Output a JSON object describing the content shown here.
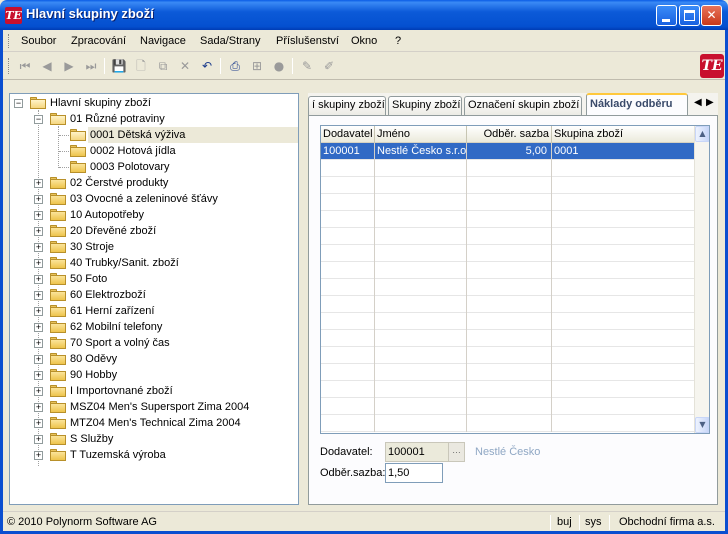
{
  "window": {
    "title": "Hlavní skupiny zboží",
    "app_icon_text": "TE",
    "controls": {
      "minimize": "minimize-icon",
      "maximize": "maximize-icon",
      "close": "✕"
    }
  },
  "menu": {
    "items": [
      "Soubor",
      "Zpracování",
      "Navigace",
      "Sada/Strany",
      "Příslušenství",
      "Okno",
      "?"
    ]
  },
  "toolbar": {
    "buttons": [
      {
        "icon": "first-record-icon",
        "glyph": "⏮"
      },
      {
        "icon": "previous-record-icon",
        "glyph": "◀"
      },
      {
        "icon": "next-record-icon",
        "glyph": "▶"
      },
      {
        "icon": "last-record-icon",
        "glyph": "⏭"
      },
      {
        "icon": "save-icon",
        "glyph": "💾"
      },
      {
        "icon": "new-document-icon",
        "glyph": "🗋"
      },
      {
        "icon": "copy-icon",
        "glyph": "⧉"
      },
      {
        "icon": "delete-icon",
        "glyph": "✕"
      },
      {
        "icon": "undo-icon",
        "glyph": "↶"
      },
      {
        "icon": "print-icon",
        "glyph": "⎙"
      },
      {
        "icon": "tree-view-icon",
        "glyph": "⊞"
      },
      {
        "icon": "stop-icon",
        "glyph": "●"
      },
      {
        "icon": "edit-icon",
        "glyph": "✎"
      },
      {
        "icon": "edit-clear-icon",
        "glyph": "✐"
      }
    ],
    "logo_text": "TE"
  },
  "tree": {
    "root_label": "Hlavní skupiny zboží",
    "nodes": [
      {
        "label": "01  Různé potraviny",
        "expanded": true,
        "level": 1
      },
      {
        "label": "0001  Dětská výživa",
        "level": 2,
        "selected": true,
        "open": true
      },
      {
        "label": "0002  Hotová jídla",
        "level": 2
      },
      {
        "label": "0003  Polotovary",
        "level": 2
      },
      {
        "label": "02  Čerstvé produkty",
        "level": 1
      },
      {
        "label": "03  Ovocné a zeleninové šťávy",
        "level": 1
      },
      {
        "label": "10  Autopotřeby",
        "level": 1
      },
      {
        "label": "20  Dřevěné zboží",
        "level": 1
      },
      {
        "label": "30  Stroje",
        "level": 1
      },
      {
        "label": "40  Trubky/Sanit. zboží",
        "level": 1
      },
      {
        "label": "50  Foto",
        "level": 1
      },
      {
        "label": "60  Elektrozboží",
        "level": 1
      },
      {
        "label": "61  Herní zařízení",
        "level": 1
      },
      {
        "label": "62  Mobilní telefony",
        "level": 1
      },
      {
        "label": "70  Sport a volný čas",
        "level": 1
      },
      {
        "label": "80  Oděvy",
        "level": 1
      },
      {
        "label": "90  Hobby",
        "level": 1
      },
      {
        "label": "I  Importovnané zboží",
        "level": 1
      },
      {
        "label": "MSZ04  Men's Supersport Zima 2004",
        "level": 1
      },
      {
        "label": "MTZ04  Men's Technical Zima 2004",
        "level": 1
      },
      {
        "label": "S  Služby",
        "level": 1
      },
      {
        "label": "T  Tuzemská výroba",
        "level": 1
      }
    ]
  },
  "tabs": {
    "items": [
      {
        "label": "í skupiny zboží"
      },
      {
        "label": "Skupiny zboží"
      },
      {
        "label": "Označení skupin zboží"
      },
      {
        "label": "Náklady odběru",
        "active": true
      }
    ],
    "nav_left": "◀",
    "nav_right": "▶"
  },
  "grid": {
    "columns": [
      "Dodavatel",
      "Jméno",
      "Odběr. sazba",
      "Skupina zboží"
    ],
    "rows": [
      {
        "dodavatel": "100001",
        "jmeno": "Nestlé Česko s.r.o.",
        "sazba": "5,00",
        "skupina": "0001",
        "selected": true
      }
    ],
    "scroll_up": "▲",
    "scroll_down": "▼"
  },
  "form": {
    "dodavatel_label": "Dodavatel:",
    "dodavatel_value": "100001",
    "dodavatel_name": "Nestlé Česko",
    "lookup_glyph": "…",
    "sazba_label": "Odběr.sazba:",
    "sazba_value": "1,50"
  },
  "status": {
    "copyright": "© 2010 Polynorm Software AG",
    "user": "buj",
    "db": "sys",
    "company": "Obchodní firma a.s."
  },
  "colors": {
    "titlebar": "#0450d0",
    "selection": "#316ac5",
    "active_tab_accent": "#ffc83c",
    "logo": "#c8102e"
  }
}
